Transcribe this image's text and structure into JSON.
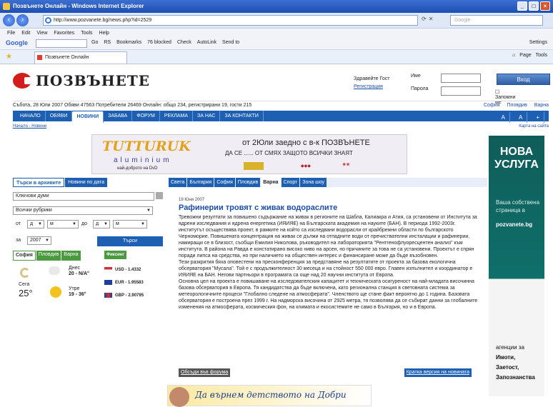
{
  "window": {
    "title": "Позвънете Онлайн - Windows Internet Explorer"
  },
  "addressbar": {
    "url": "http://www.pozvanete.bg/news.php?id=2529",
    "search_placeholder": "Google"
  },
  "menu": [
    "File",
    "Edit",
    "View",
    "Favorites",
    "Tools",
    "Help"
  ],
  "googlebar": {
    "logo": "Google",
    "items": [
      "Go",
      "RS",
      "Bookmarks",
      "76 blocked",
      "Check",
      "AutoLink",
      "Send to"
    ],
    "settings": "Settings"
  },
  "tab": {
    "label": "Позвънете Онлайн"
  },
  "tabtools": [
    "Page",
    "Tools"
  ],
  "site": {
    "logo": "ПОЗВЪНЕТЕ"
  },
  "welcome": {
    "greeting": "Здравейте Гост",
    "register": "Регистрация"
  },
  "login": {
    "user_label": "Име",
    "pass_label": "Парола",
    "button": "Вход",
    "remember": "Запомни ме"
  },
  "stats": {
    "text": "Събота, 28 Юли 2007   Обяви 47563   Потребители 26469   Онлайн: общо 234, регистрирани 19, гости 215",
    "links": [
      "София",
      "Пловдив",
      "Варна"
    ]
  },
  "nav": {
    "items": [
      "НАЧАЛО",
      "ОБЯВИ",
      "НОВИНИ",
      "ЗАБАВА",
      "ФОРУМ",
      "РЕКЛАМА",
      "ЗА НАС",
      "ЗА КОНТАКТИ"
    ],
    "active_index": 2,
    "font_controls": [
      "A",
      "A",
      "+"
    ]
  },
  "crumb": {
    "text": "Начало - Новини",
    "map": "Карта на сайта"
  },
  "banner": {
    "brand": "TUTTURUK",
    "sub": "aluminium",
    "tag": "най-доброто на DvD",
    "headline": "от 2Юли заедно с в-к ПОЗВЪНЕТЕ",
    "slogan": "ДА СЕ ...... ОТ СМЯХ  ЗАЩОТО ВСИЧКИ ЗНАЯТ"
  },
  "rightad": {
    "title": "НОВА УСЛУГА",
    "text": "Ваша собствена страница в",
    "site": "pozvanete.bg",
    "bottom_intro": "агенции за",
    "bottom_items": [
      "Имоти,",
      "Заетост,",
      "Запознанства"
    ]
  },
  "left_tabs": [
    "Търси в архивите",
    "Новини по дата"
  ],
  "search": {
    "keywords_placeholder": "Ключови думи",
    "category": "Всички рубрики",
    "from_label": "от",
    "to_label": "до",
    "day": "д",
    "month": "м",
    "za_label": "за",
    "year": "2007",
    "button": "Търси"
  },
  "weather": {
    "tabs": [
      "София",
      "Пловдив",
      "Варна"
    ],
    "now_label": "Сега",
    "now_temp": "25°",
    "today_label": "Днес",
    "today_temp": "20 - N/A°",
    "tomorrow_label": "Утре",
    "tomorrow_temp": "19 - 36°"
  },
  "fixing": {
    "title": "Фиксинг",
    "rows": [
      {
        "code": "USD",
        "rate": "1.4332"
      },
      {
        "code": "EUR",
        "rate": "1.95583"
      },
      {
        "code": "GBP",
        "rate": "2.90795"
      }
    ]
  },
  "city_tabs": {
    "items": [
      "Света",
      "България",
      "София",
      "Пловдив",
      "Варна",
      "Спорт",
      "Зона шоу"
    ],
    "active_index": 4
  },
  "article": {
    "date": "19 Юни 2007",
    "title": "Рафинерии тровят с живак водораслите",
    "body": [
      "Тревожни резултати за повишено съдържание на живак в регионите на Шабла, Калиакра и Атия, са установени от Института за ядрени изследвания и ядрена енергетика (ИЯИЯЕ) на Българската академия на науките (БАН). В периода 1992-2003г. институтът осъществява проект, в рамките на който са изследвани водорасли от крайбрежни области по българското Черноморие. Повишената концентрация на живак се дължи на отпадните води от пречиствателни инсталации и рафинерии, намиращи се в близост, съобщи Емилия Николова, ръководител на лабораторията \"Рентгенофлуоресцентен анализ\" към института. В района на Равда е констатирано високо ниво на арсен, но причините за това не са установени. Проектът е спрян поради липса на средства, но при наличието на обществен интерес и финансиране може да бъде възобновен.",
      "Тези разкрития бяха оповестени на пресконференция за представяне на резултатите от проекта за базова екологична обсерватория \"Мусала\". Той е с продължителност 30 месеца и на стойност 550 000 евро. Главен изпълнител и координатор е ИЯИЯЕ на БАН. Негови партньори в програмата са още над 20 научни института от Европа.",
      "Основна цел на проекта е повишаване на изследователския капацитет и техническата осигуреност на най-младата височинна базова обсерватория в Европа. Тя кандидатства да бъде включена, като регионална станция в световната система за метеорологичните процеси \"Глобално следене на атмосферата\". Членството ще стане факт вероятно до 1 година. Базовата обсерватория е построена през 1999 г. На надморска височина от 2925 метра, тя позволява да се събират данни за глобалните изменения на атмосферата, космическия фон, на климата и екосистемите не само в България, но и в Европа."
    ]
  },
  "links": {
    "forum": "Обсъди във форума",
    "short": "Кратка версия на новината"
  },
  "bottomad": {
    "text": "Да върнем детството на Добри"
  }
}
